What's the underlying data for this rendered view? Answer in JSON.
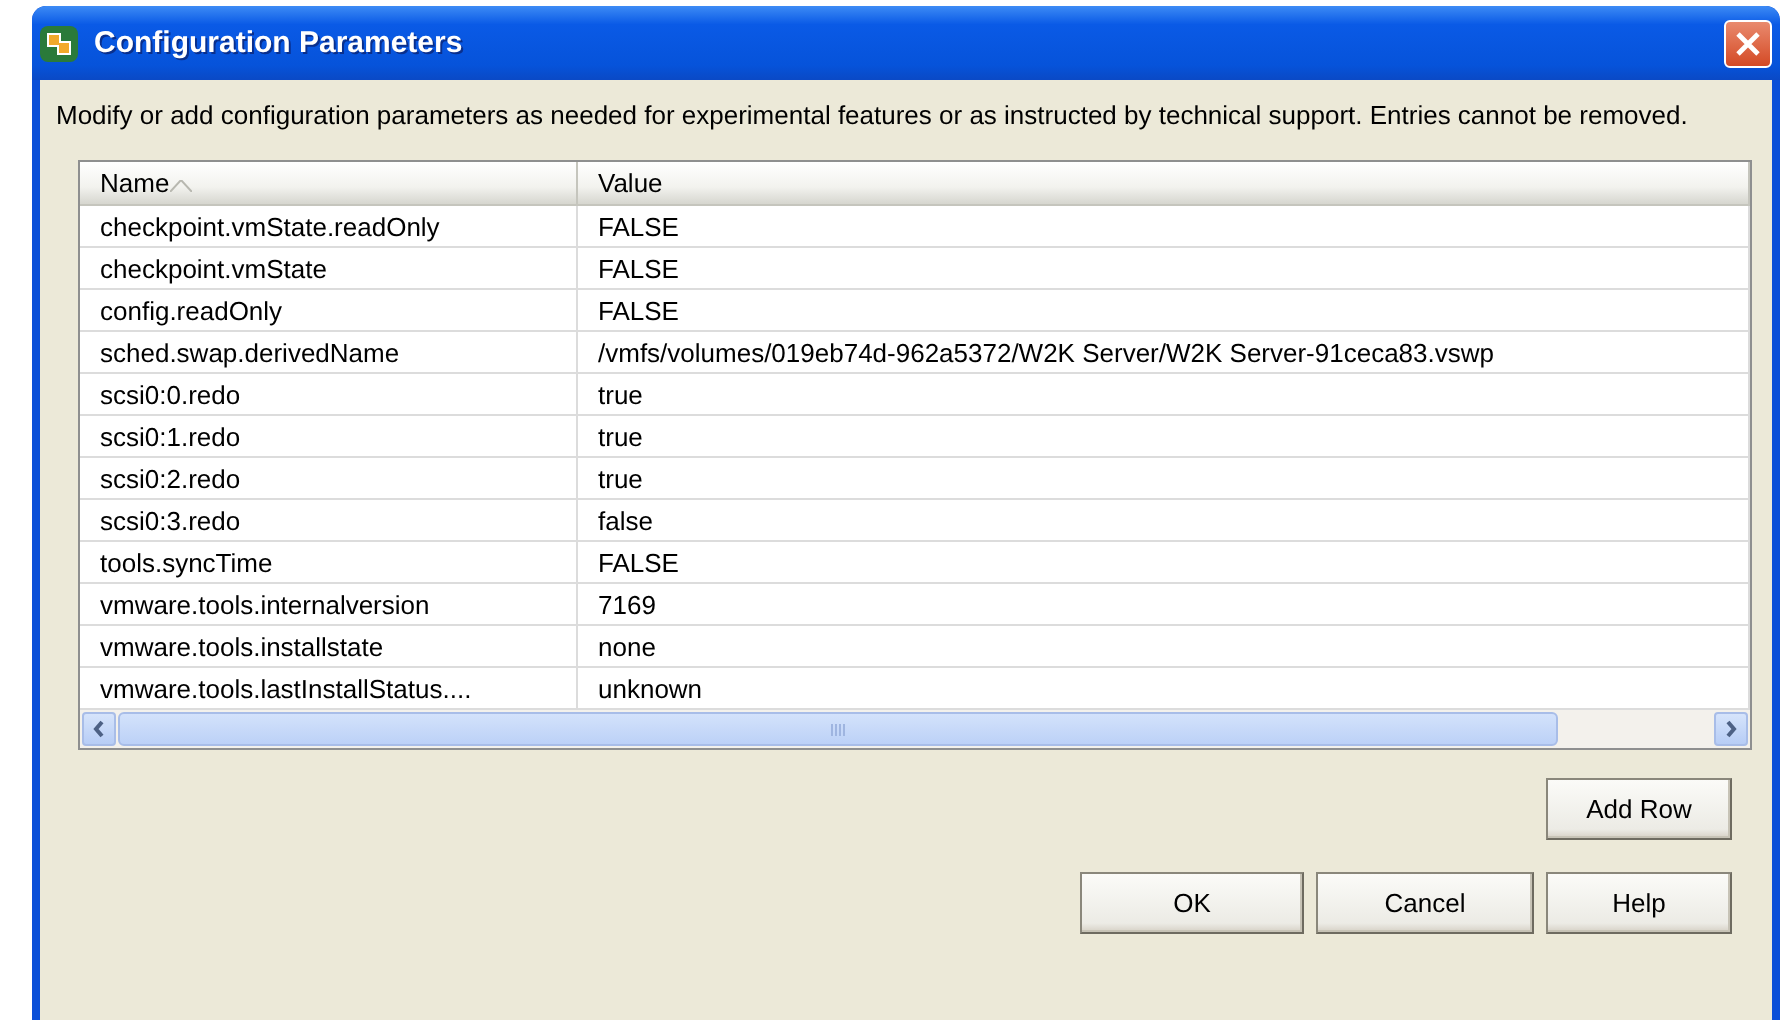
{
  "window": {
    "title": "Configuration Parameters"
  },
  "description": "Modify or add configuration parameters as needed for experimental features or as instructed by technical support. Entries cannot be removed.",
  "table": {
    "columns": [
      {
        "label": "Name",
        "sorted": true
      },
      {
        "label": "Value",
        "sorted": false
      }
    ],
    "rows": [
      {
        "name": "checkpoint.vmState.readOnly",
        "value": "FALSE"
      },
      {
        "name": "checkpoint.vmState",
        "value": "FALSE"
      },
      {
        "name": "config.readOnly",
        "value": "FALSE"
      },
      {
        "name": "sched.swap.derivedName",
        "value": "/vmfs/volumes/019eb74d-962a5372/W2K Server/W2K Server-91ceca83.vswp"
      },
      {
        "name": "scsi0:0.redo",
        "value": "true"
      },
      {
        "name": "scsi0:1.redo",
        "value": "true"
      },
      {
        "name": "scsi0:2.redo",
        "value": "true"
      },
      {
        "name": "scsi0:3.redo",
        "value": "false"
      },
      {
        "name": "tools.syncTime",
        "value": "FALSE"
      },
      {
        "name": "vmware.tools.internalversion",
        "value": "7169"
      },
      {
        "name": "vmware.tools.installstate",
        "value": "none"
      },
      {
        "name": "vmware.tools.lastInstallStatus....",
        "value": "unknown"
      }
    ]
  },
  "add_button": "Add Row",
  "buttons": [
    "OK",
    "Cancel",
    "Help"
  ]
}
